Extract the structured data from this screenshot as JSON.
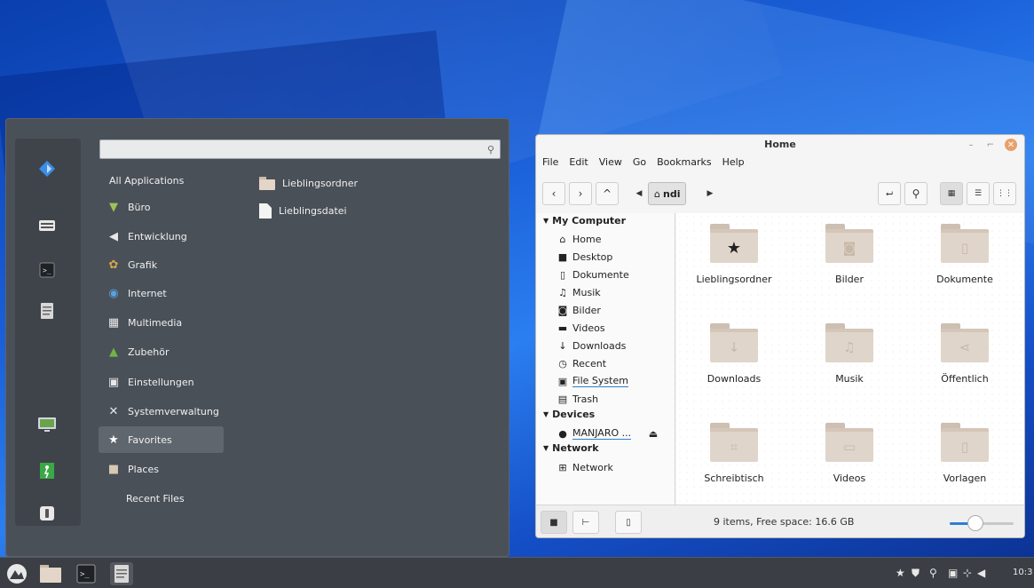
{
  "menu": {
    "search": {
      "value": "",
      "placeholder": ""
    },
    "categories": [
      {
        "label": "All Applications",
        "icon": "none",
        "selected": false
      },
      {
        "label": "Büro",
        "icon": "office-icon",
        "selected": false
      },
      {
        "label": "Entwicklung",
        "icon": "development-icon",
        "selected": false
      },
      {
        "label": "Grafik",
        "icon": "graphics-icon",
        "selected": false
      },
      {
        "label": "Internet",
        "icon": "globe-icon",
        "selected": false
      },
      {
        "label": "Multimedia",
        "icon": "multimedia-icon",
        "selected": false
      },
      {
        "label": "Zubehör",
        "icon": "accessories-icon",
        "selected": false
      },
      {
        "label": "Einstellungen",
        "icon": "settings-icon",
        "selected": false
      },
      {
        "label": "Systemverwaltung",
        "icon": "admin-tools-icon",
        "selected": false
      },
      {
        "label": "Favorites",
        "icon": "star-icon",
        "selected": true
      },
      {
        "label": "Places",
        "icon": "folder-icon",
        "selected": false
      },
      {
        "label": "Recent Files",
        "icon": "none",
        "selected": false
      }
    ],
    "apps": [
      {
        "label": "Lieblingsordner",
        "icon": "folder-icon"
      },
      {
        "label": "Lieblingsdatei",
        "icon": "file-icon"
      }
    ],
    "sidebar_icons": [
      "browser-icon",
      "keyboard-icon",
      "terminal-icon",
      "text-editor-icon",
      "lock-screen-icon",
      "logout-icon",
      "shutdown-icon"
    ]
  },
  "filemanager": {
    "title": "Home",
    "menubar": [
      "File",
      "Edit",
      "View",
      "Go",
      "Bookmarks",
      "Help"
    ],
    "breadcrumb": "ndi",
    "sidebar": {
      "sections": [
        {
          "label": "My Computer",
          "items": [
            "Home",
            "Desktop",
            "Dokumente",
            "Musik",
            "Bilder",
            "Videos",
            "Downloads",
            "Recent",
            "File System",
            "Trash"
          ]
        },
        {
          "label": "Devices",
          "items": [
            "MANJARO ..."
          ]
        },
        {
          "label": "Network",
          "items": [
            "Network"
          ]
        }
      ]
    },
    "folders": [
      {
        "name": "Lieblingsordner",
        "glyph": "★"
      },
      {
        "name": "Bilder",
        "glyph": "◙"
      },
      {
        "name": "Dokumente",
        "glyph": "▯"
      },
      {
        "name": "Downloads",
        "glyph": "↓"
      },
      {
        "name": "Musik",
        "glyph": "♫"
      },
      {
        "name": "Öffentlich",
        "glyph": "⋖"
      },
      {
        "name": "Schreibtisch",
        "glyph": "⌗"
      },
      {
        "name": "Videos",
        "glyph": "▭"
      },
      {
        "name": "Vorlagen",
        "glyph": "▯"
      }
    ],
    "status": "9 items, Free space: 16.6 GB",
    "zoom_level": 0.4
  },
  "taskbar": {
    "clock": "10:3",
    "tray_icons": [
      "favorites-star-icon",
      "shield-icon",
      "network-wifi-icon",
      "clipboard-icon",
      "network-icon",
      "volume-icon"
    ]
  }
}
